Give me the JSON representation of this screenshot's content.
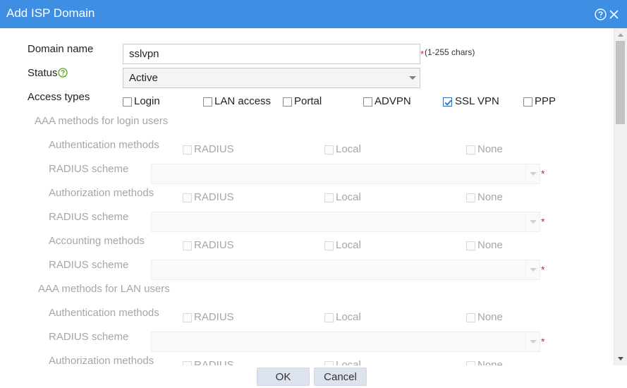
{
  "dialog": {
    "title": "Add ISP Domain",
    "help_icon": "help-circle-icon",
    "close_icon": "close-icon"
  },
  "form": {
    "domain_name": {
      "label": "Domain name",
      "value": "sslvpn",
      "required_mark": "*",
      "hint": "(1-255 chars)"
    },
    "status": {
      "label": "Status",
      "icon": "question-circle-icon",
      "value": "Active"
    },
    "access_types": {
      "label": "Access types",
      "options": [
        {
          "label": "Login",
          "checked": false
        },
        {
          "label": "LAN access",
          "checked": false
        },
        {
          "label": "Portal",
          "checked": false
        },
        {
          "label": "ADVPN",
          "checked": false
        },
        {
          "label": "SSL VPN",
          "checked": true
        },
        {
          "label": "PPP",
          "checked": false
        }
      ]
    },
    "login_section": {
      "title": "AAA methods for login users",
      "authentication": {
        "label": "Authentication methods",
        "options": [
          "RADIUS",
          "Local",
          "None"
        ]
      },
      "radius_scheme_1": {
        "label": "RADIUS scheme",
        "required_mark": "*"
      },
      "authorization": {
        "label": "Authorization methods",
        "options": [
          "RADIUS",
          "Local",
          "None"
        ]
      },
      "radius_scheme_2": {
        "label": "RADIUS scheme",
        "required_mark": "*"
      },
      "accounting": {
        "label": "Accounting methods",
        "options": [
          "RADIUS",
          "Local",
          "None"
        ]
      },
      "radius_scheme_3": {
        "label": "RADIUS scheme",
        "required_mark": "*"
      }
    },
    "lan_section": {
      "title": "AAA methods for LAN users",
      "authentication": {
        "label": "Authentication methods",
        "options": [
          "RADIUS",
          "Local",
          "None"
        ]
      },
      "radius_scheme_1": {
        "label": "RADIUS scheme",
        "required_mark": "*"
      },
      "authorization": {
        "label": "Authorization methods",
        "options": [
          "RADIUS",
          "Local",
          "None"
        ]
      }
    }
  },
  "footer": {
    "ok_label": "OK",
    "cancel_label": "Cancel"
  },
  "colors": {
    "titlebar": "#3e8fe3",
    "required": "#e0201c",
    "disabled_text": "#a6a6a6",
    "button_bg": "#dde3ee",
    "checkbox_check": "#2b6fc2",
    "help_icon": "#5aa61f"
  }
}
